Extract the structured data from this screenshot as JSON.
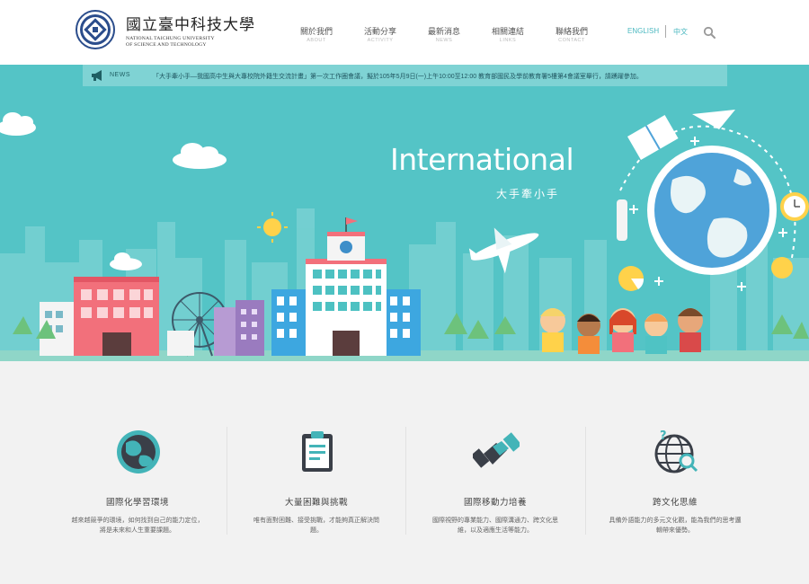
{
  "header": {
    "logo_cn": "國立臺中科技大學",
    "logo_en_line1": "NATIONAL TAICHUNG UNIVERSITY",
    "logo_en_line2": "OF SCIENCE AND TECHNOLOGY",
    "nav": [
      {
        "label": "關於我們",
        "sub": "ABOUT"
      },
      {
        "label": "活動分享",
        "sub": "ACTIVITY"
      },
      {
        "label": "最新消息",
        "sub": "NEWS"
      },
      {
        "label": "相關連結",
        "sub": "LINKS"
      },
      {
        "label": "聯絡我們",
        "sub": "CONTACT"
      }
    ],
    "lang_en": "ENGLISH",
    "lang_zh": "中文",
    "search_icon": "search-icon"
  },
  "news": {
    "tag": "NEWS",
    "icon": "megaphone-icon",
    "text": "「大手牽小手—我國高中生與大專校院外籍生交流計畫」第一次工作圈會議，擬於105年5月9日(一)上午10:00至12:00 教育部國民及學前教育署5樓第4會議室舉行，請踴躍參加。"
  },
  "hero": {
    "title": "International",
    "subtitle": "大手牽小手",
    "colors": {
      "sky": "#54c4c6",
      "accent": "#ff6f61"
    }
  },
  "features": [
    {
      "title": "國際化學習環境",
      "desc": "越來越競爭的環境，如何找到自己的能力定位，將是未來和人生重要課題。",
      "icon": "globe-icon"
    },
    {
      "title": "大量困難與挑戰",
      "desc": "唯有面對困難、接受挑戰，才能夠真正解決問題。",
      "icon": "clipboard-icon"
    },
    {
      "title": "國際移動力培養",
      "desc": "國際視野的專業能力、國際溝通力、跨文化思維，以及適應生活等能力。",
      "icon": "handshake-icon"
    },
    {
      "title": "跨文化思維",
      "desc": "具備外語能力的多元文化觀，能為我們的思考邏輯帶來優勢。",
      "icon": "globe-search-icon"
    }
  ]
}
